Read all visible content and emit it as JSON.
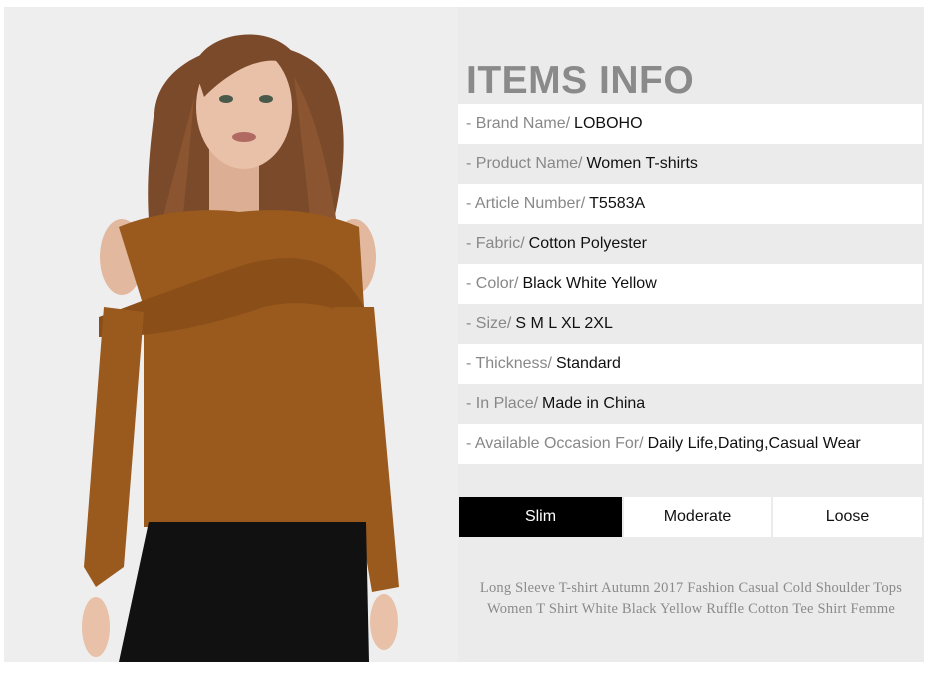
{
  "photo": {
    "icon": "model-wearing-brown-cold-shoulder-top",
    "colors": {
      "top": "#9a5a1e",
      "hair": "#7a4a2a",
      "skin": "#e8c1a8",
      "pants": "#111111",
      "background": "#eeeeef"
    }
  },
  "info": {
    "title": "ITEMS INFO",
    "rows": [
      {
        "label": "- Brand Name/",
        "value": "LOBOHO"
      },
      {
        "label": "- Product Name/",
        "value": "Women T-shirts"
      },
      {
        "label": "- Article Number/",
        "value": "T5583A"
      },
      {
        "label": "- Fabric/",
        "value": "Cotton Polyester"
      },
      {
        "label": "- Color/",
        "value": "Black White Yellow"
      },
      {
        "label": "- Size/",
        "value": "S M L XL 2XL"
      },
      {
        "label": "- Thickness/",
        "value": "Standard"
      },
      {
        "label": "- In Place/",
        "value": "Made in China"
      },
      {
        "label": "- Available Occasion For/",
        "value": "Daily Life,Dating,Casual Wear"
      }
    ],
    "fit": {
      "options": [
        "Slim",
        "Moderate",
        "Loose"
      ],
      "selected": "Slim"
    },
    "description_line1": "Long Sleeve T-shirt Autumn 2017 Fashion Casual Cold Shoulder Tops",
    "description_line2": "Women T Shirt White Black Yellow Ruffle Cotton Tee Shirt Femme"
  }
}
